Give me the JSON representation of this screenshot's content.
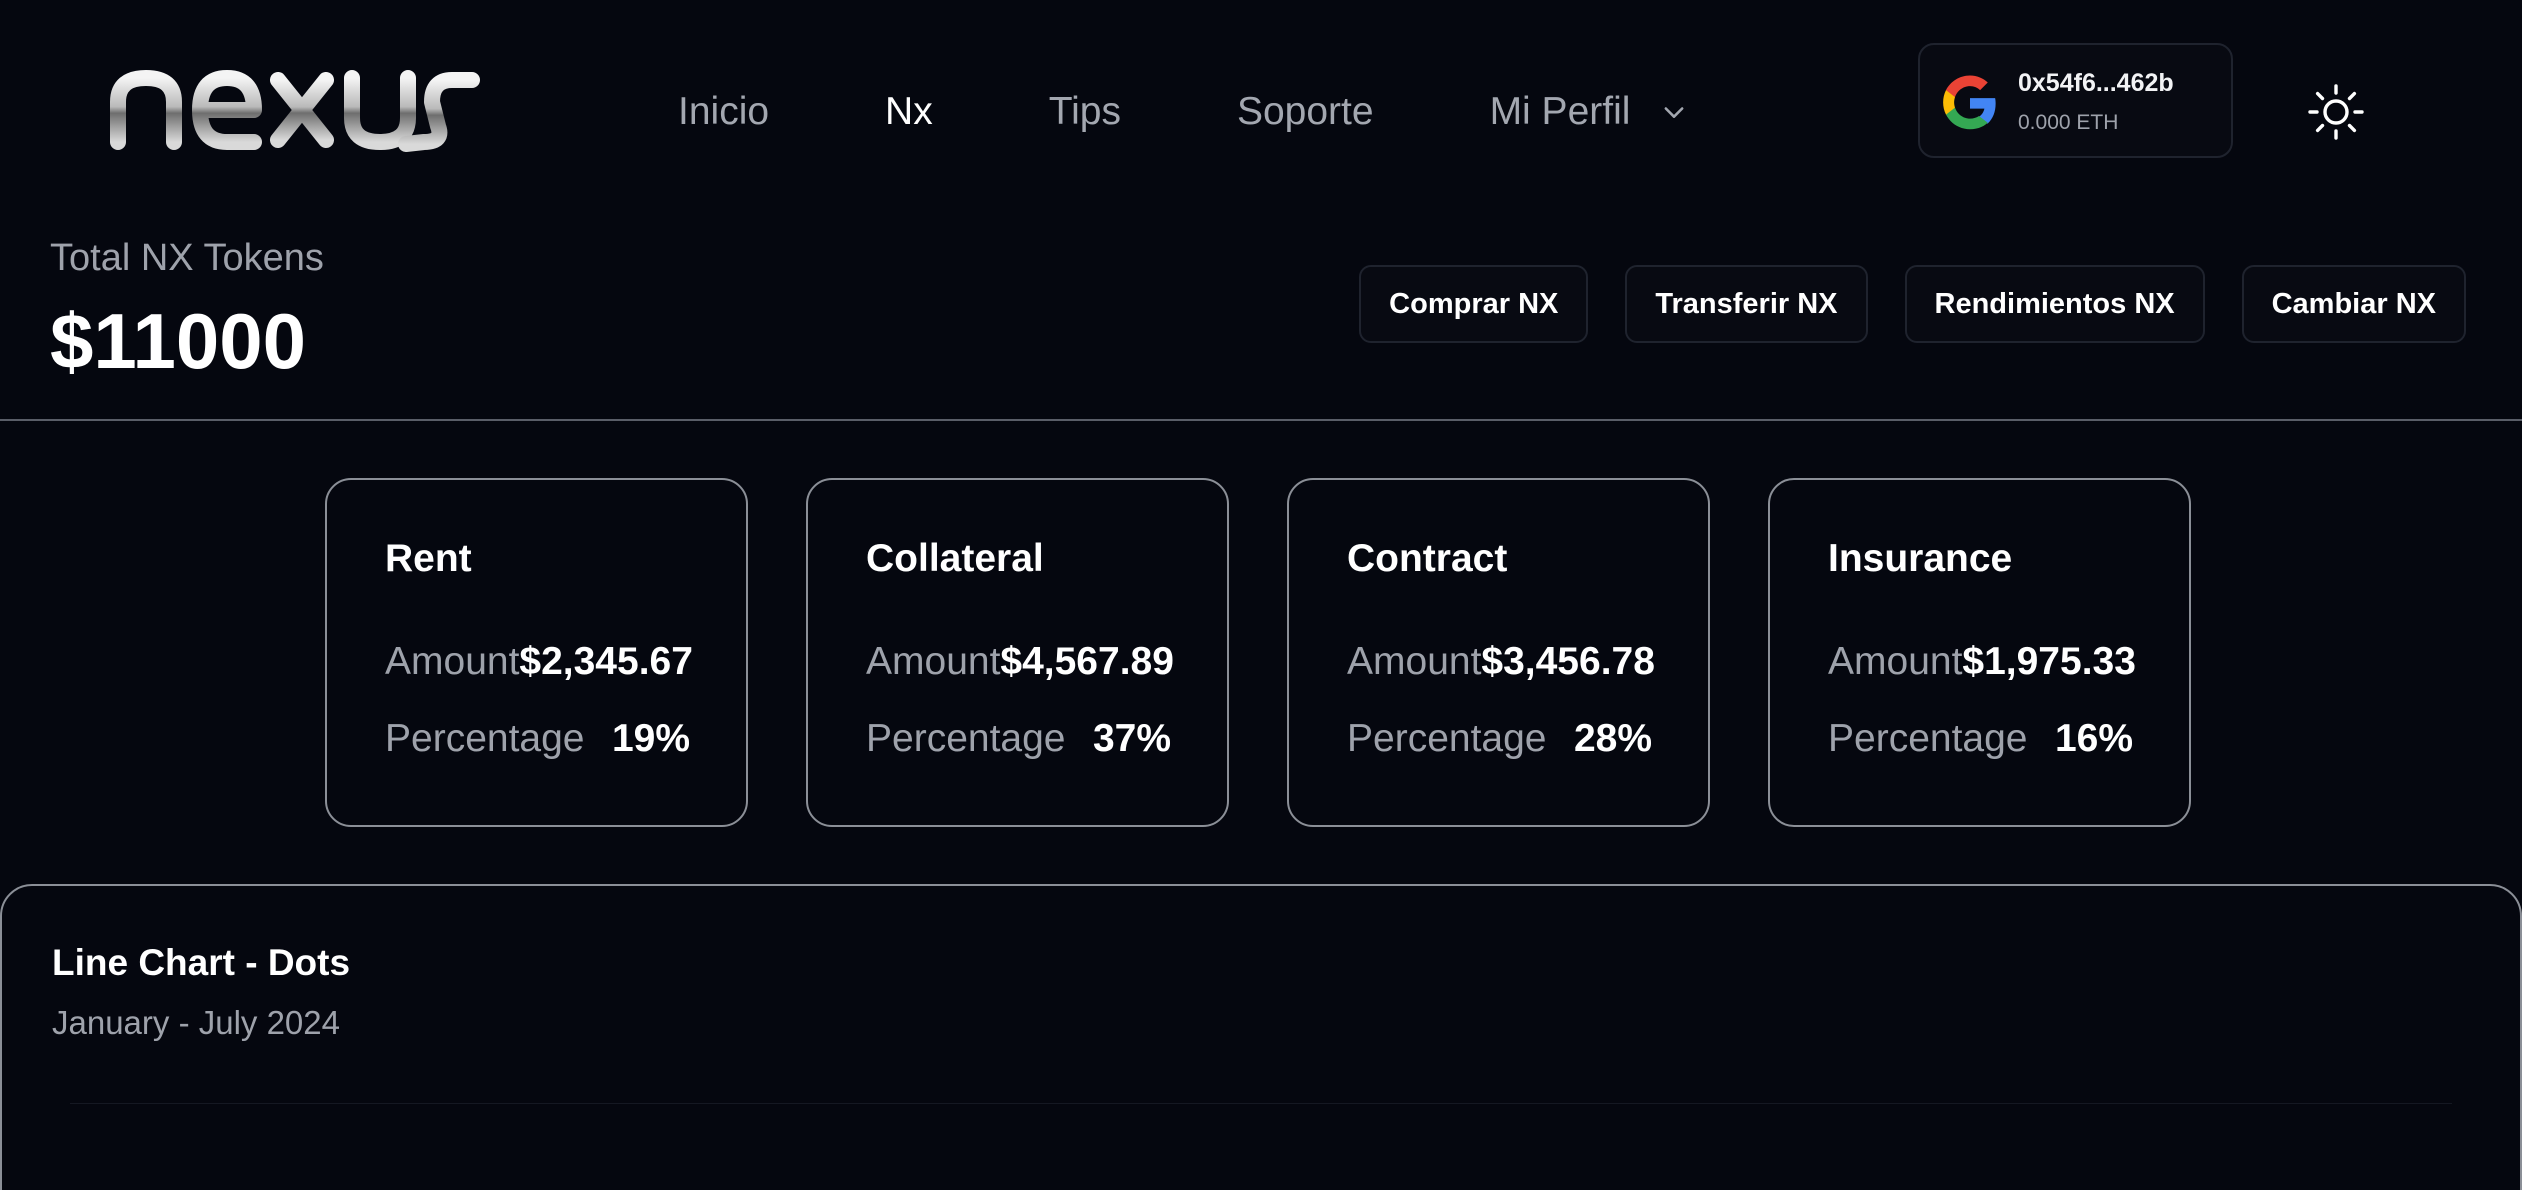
{
  "header": {
    "logo_text": "nexus",
    "nav": [
      {
        "label": "Inicio",
        "active": false
      },
      {
        "label": "Nx",
        "active": true
      },
      {
        "label": "Tips",
        "active": false
      },
      {
        "label": "Soporte",
        "active": false
      },
      {
        "label": "Mi Perfil",
        "active": false
      }
    ],
    "wallet": {
      "address": "0x54f6...462b",
      "balance": "0.000 ETH",
      "provider_icon": "google-icon"
    },
    "theme_icon": "sun-icon"
  },
  "summary": {
    "label": "Total NX Tokens",
    "value": "$11000"
  },
  "actions": [
    {
      "label": "Comprar NX"
    },
    {
      "label": "Transferir NX"
    },
    {
      "label": "Rendimientos NX"
    },
    {
      "label": "Cambiar NX"
    }
  ],
  "cards": [
    {
      "title": "Rent",
      "amount_label": "Amount",
      "amount": "$2,345.67",
      "percentage_label": "Percentage",
      "percentage": "19%"
    },
    {
      "title": "Collateral",
      "amount_label": "Amount",
      "amount": "$4,567.89",
      "percentage_label": "Percentage",
      "percentage": "37%"
    },
    {
      "title": "Contract",
      "amount_label": "Amount",
      "amount": "$3,456.78",
      "percentage_label": "Percentage",
      "percentage": "28%"
    },
    {
      "title": "Insurance",
      "amount_label": "Amount",
      "amount": "$1,975.33",
      "percentage_label": "Percentage",
      "percentage": "16%"
    }
  ],
  "chart": {
    "title": "Line Chart - Dots",
    "subtitle": "January - July 2024"
  },
  "colors": {
    "background": "#05070f",
    "text": "#ffffff",
    "muted": "#9ea2ab",
    "border": "#8b8f97"
  }
}
